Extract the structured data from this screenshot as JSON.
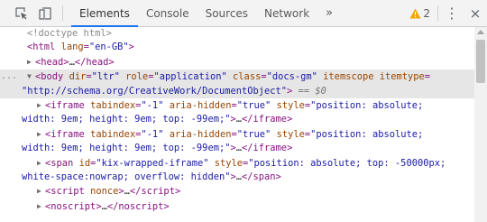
{
  "toolbar": {
    "icons": [
      "inspect-element-icon",
      "device-toolbar-icon"
    ],
    "tabs": [
      {
        "label": "Elements",
        "active": true
      },
      {
        "label": "Console",
        "active": false
      },
      {
        "label": "Sources",
        "active": false
      },
      {
        "label": "Network",
        "active": false
      }
    ],
    "more_tabs": "»",
    "warning_count": "2",
    "menu_icon": "⋮",
    "close_icon": "×",
    "warning_color": "#f2a600",
    "active_tab_color": "#1a73e8"
  },
  "dom": {
    "doctype": "<!doctype html>",
    "html_open_tag": "html",
    "html_lang_attr": "lang",
    "html_lang_val": "\"en-GB\"",
    "head_tag": "head",
    "head_close": "/head",
    "body_gutter": "...",
    "body_tag": "body",
    "body_attr1": "dir",
    "body_val1": "\"ltr\"",
    "body_attr2": "role",
    "body_val2": "\"application\"",
    "body_attr3": "class",
    "body_val3": "\"docs-gm\"",
    "body_attr4": "itemscope",
    "body_attr5": "itemtype",
    "body_val5": "\"http://schema.org/CreativeWork/DocumentObject\"",
    "body_marker": "== $0",
    "iframe_tag": "iframe",
    "iframe_attr1": "tabindex",
    "iframe_val1": "\"-1\"",
    "iframe_attr2": "aria-hidden",
    "iframe_val2": "\"true\"",
    "iframe_attr3": "style",
    "iframe_val3a": "\"position: absolute;",
    "iframe_val3b": "width: 9em; height: 9em; top: -99em;\"",
    "iframe_close": "/iframe",
    "span_tag": "span",
    "span_attr1": "id",
    "span_val1": "\"kix-wrapped-iframe\"",
    "span_attr2": "style",
    "span_val2a": "\"position: absolute; top: -50000px;",
    "span_val2b": "white-space:nowrap; overflow: hidden\"",
    "span_close": "/span",
    "script_tag": "script",
    "script_attr": "nonce",
    "script_close": "/script",
    "noscript_tag": "noscript",
    "noscript_close": "/noscript",
    "collapsed": "…"
  }
}
